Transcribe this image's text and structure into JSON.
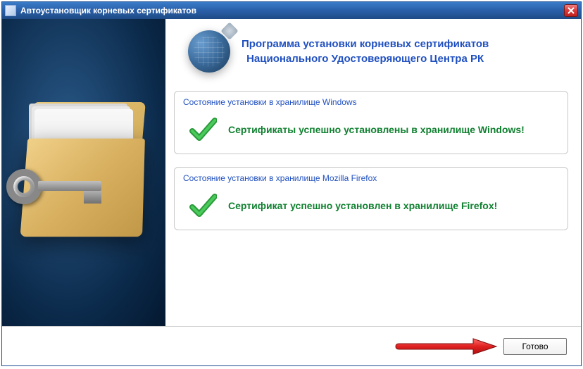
{
  "window": {
    "title": "Автоустановщик корневых сертификатов"
  },
  "header": {
    "line1": "Программа установки корневых сертификатов",
    "line2": "Национального Удостоверяющего Центра РК"
  },
  "status_windows": {
    "title": "Состояние установки в хранилище Windows",
    "message": "Сертификаты успешно установлены в хранилище Windows!"
  },
  "status_firefox": {
    "title": "Состояние установки в хранилище Mozilla Firefox",
    "message": "Сертификат успешно установлен в хранилище Firefox!"
  },
  "footer": {
    "done_label": "Готово"
  }
}
